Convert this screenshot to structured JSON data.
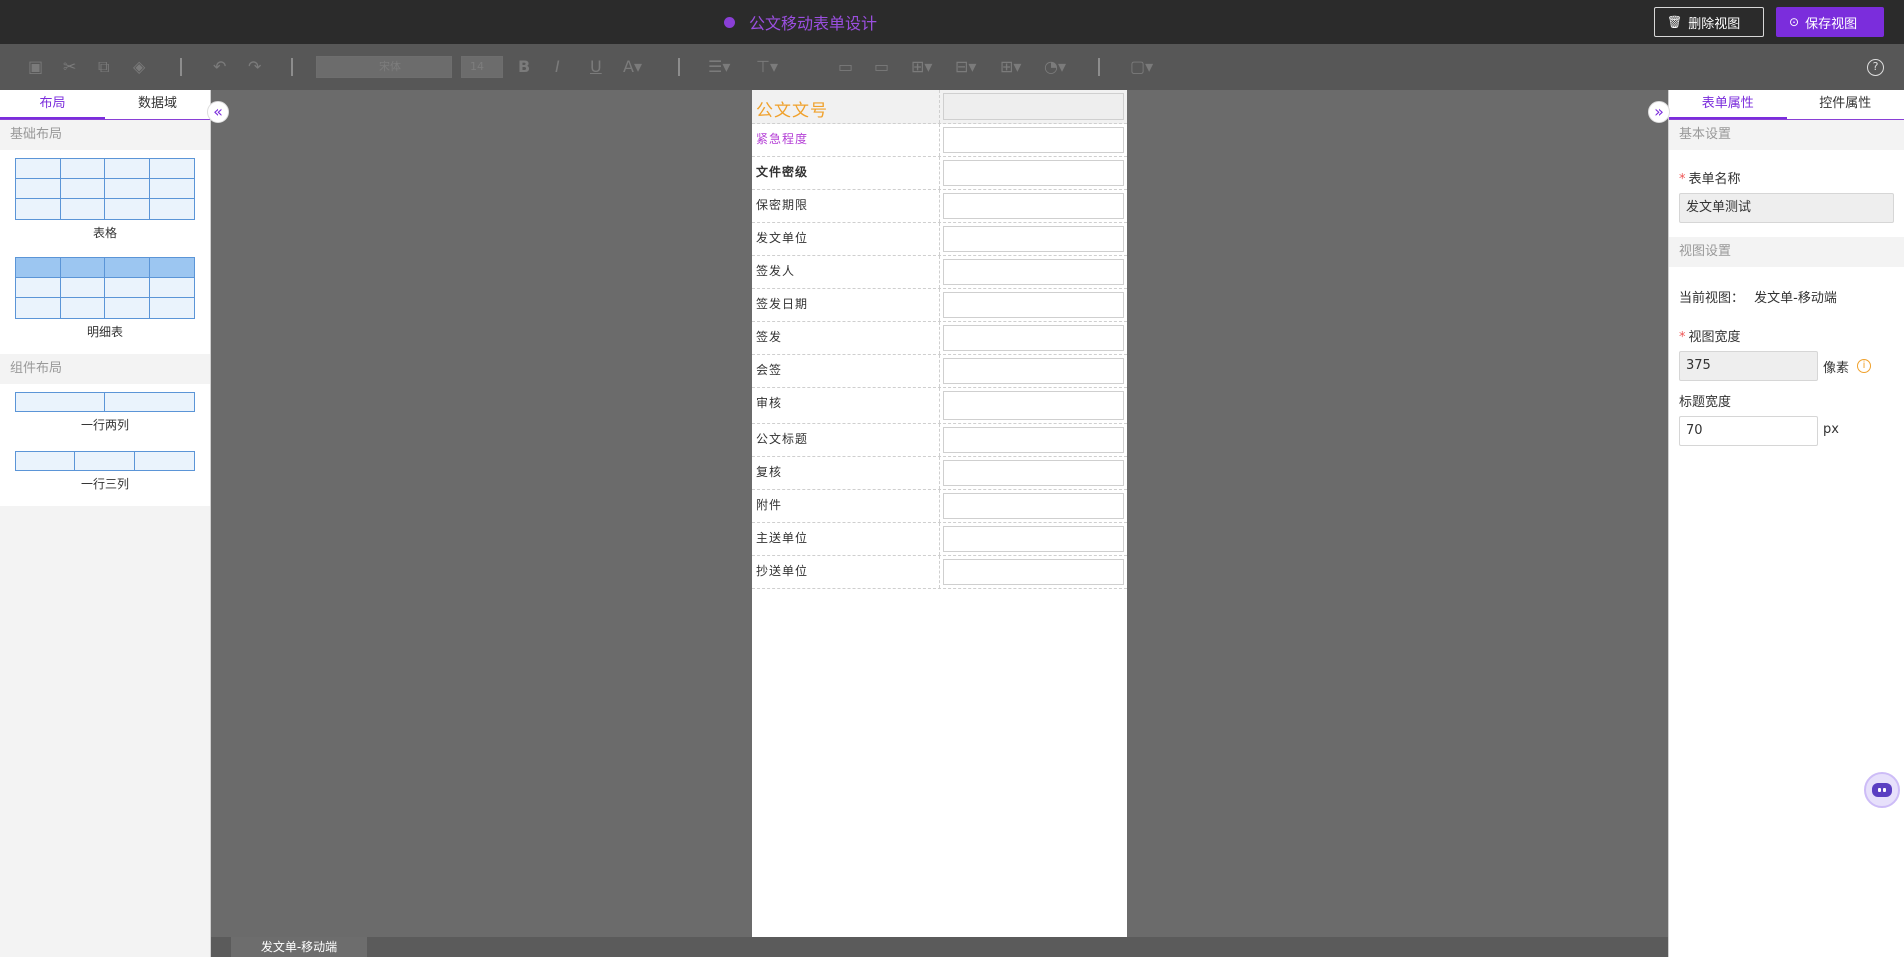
{
  "topbar": {
    "title": "公文移动表单设计",
    "delete_label": "删除视图",
    "save_label": "保存视图"
  },
  "toolbar": {
    "font_family": "宋体",
    "font_size": "14"
  },
  "left_panel": {
    "tabs": [
      "布局",
      "数据域"
    ],
    "basic_layout_title": "基础布局",
    "component_layout_title": "组件布局",
    "items": [
      "表格",
      "明细表",
      "一行两列",
      "一行三列"
    ]
  },
  "form": {
    "rows": [
      "公文文号",
      "紧急程度",
      "文件密级",
      "保密期限",
      "发文单位",
      "签发人",
      "签发日期",
      "签发",
      "会签",
      "审核",
      "公文标题",
      "复核",
      "附件",
      "主送单位",
      "抄送单位"
    ]
  },
  "bottom": {
    "view_tab": "发文单-移动端"
  },
  "right_panel": {
    "tabs": [
      "表单属性",
      "控件属性"
    ],
    "basic_settings": "基本设置",
    "form_name_label": "表单名称",
    "form_name_value": "发文单测试",
    "view_settings": "视图设置",
    "current_view_label": "当前视图：",
    "current_view_value": "发文单-移动端",
    "view_width_label": "视图宽度",
    "view_width_value": "375",
    "view_width_unit": "像素",
    "title_width_label": "标题宽度",
    "title_width_value": "70",
    "title_width_unit": "px"
  },
  "colors": {
    "accent": "#7b2ddc",
    "header_label": "#f0a12c",
    "urgent_label": "#b43fd6"
  }
}
